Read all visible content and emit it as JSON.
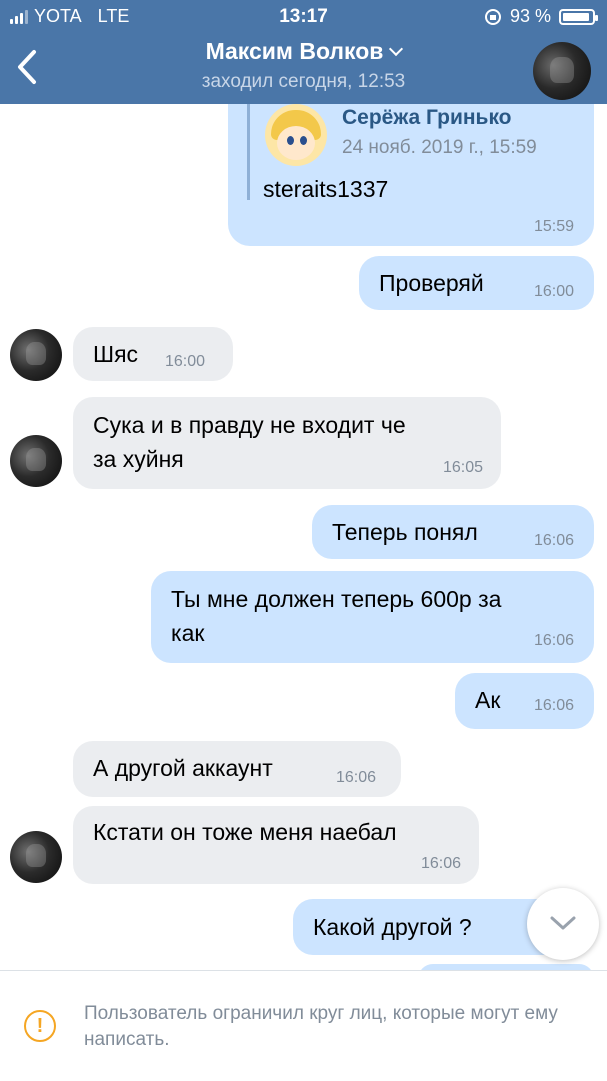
{
  "status_bar": {
    "carrier": "YOTA",
    "network": "LTE",
    "time": "13:17",
    "battery": "93 %",
    "battery_level": 0.93
  },
  "header": {
    "name": "Максим Волков",
    "status": "заходил сегодня, 12:53"
  },
  "forwarded": {
    "sender": "Серёжа Гринько",
    "date": "24 нояб. 2019 г., 15:59",
    "text": "steraits1337",
    "time": "15:59"
  },
  "messages": [
    {
      "dir": "out",
      "text": "Проверяй",
      "time": "16:00"
    },
    {
      "dir": "in",
      "text": "Шяс",
      "time": "16:00"
    },
    {
      "dir": "in",
      "text": "Сука и в правду не входит  че\nза хуйня",
      "time": "16:05"
    },
    {
      "dir": "out",
      "text": "Теперь понял",
      "time": "16:06"
    },
    {
      "dir": "out",
      "text": "Ты мне должен теперь 600р за\nкак",
      "time": "16:06"
    },
    {
      "dir": "out",
      "text": "Ак",
      "time": "16:06"
    },
    {
      "dir": "in",
      "text": "А другой аккаунт",
      "time": "16:06"
    },
    {
      "dir": "in",
      "text": "Кстати он тоже меня наебал",
      "time": "16:06"
    },
    {
      "dir": "out",
      "text": "Какой другой ?",
      "time": ""
    }
  ],
  "footer": {
    "notice": "Пользователь ограничил круг лиц, которые могут ему написать."
  },
  "icons": {
    "back": "chevron-left-icon",
    "scroll": "chevron-down-icon",
    "warning": "exclamation-circle-icon"
  }
}
